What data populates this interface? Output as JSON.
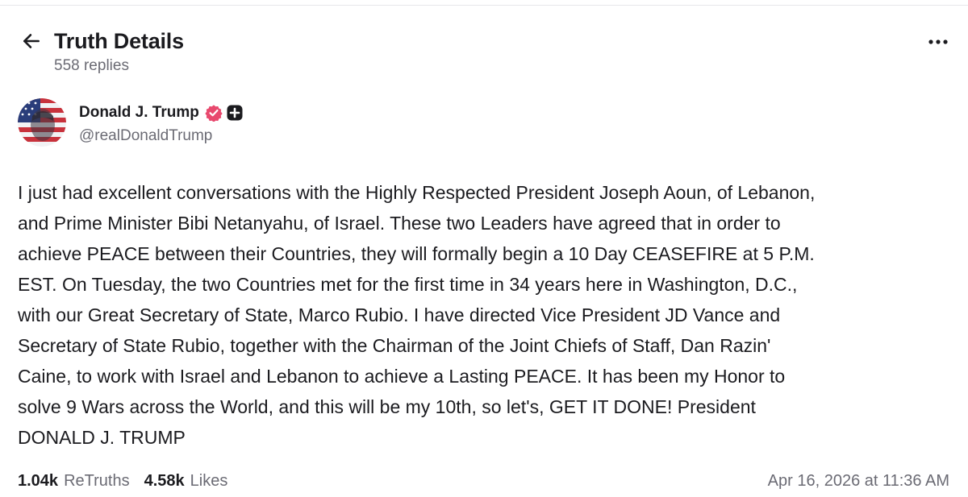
{
  "header": {
    "title": "Truth Details",
    "reply_count": "558 replies",
    "back_icon": "arrow-left-icon",
    "more_icon": "more-horizontal-icon"
  },
  "author": {
    "display_name": "Donald J. Trump",
    "handle": "@realDonaldTrump",
    "verified_color": "#e8496e",
    "badges": [
      "verified-badge-icon",
      "plus-badge-icon"
    ]
  },
  "post": {
    "text": "I just had excellent conversations with the Highly Respected President Joseph Aoun, of Lebanon,\nand Prime Minister Bibi Netanyahu, of Israel. These two Leaders have agreed that in order to\nachieve PEACE between their Countries, they will formally begin a 10 Day CEASEFIRE at 5 P.M.\nEST. On Tuesday, the two Countries met for the first time in 34 years here in Washington, D.C.,\nwith our Great Secretary of State, Marco Rubio. I have directed Vice President JD Vance and\nSecretary of State Rubio, together with the Chairman of the Joint Chiefs of Staff, Dan Razin'\nCaine, to work with Israel and Lebanon to achieve a Lasting PEACE. It has been my Honor to\nsolve 9 Wars across the World, and this will be my 10th, so let's, GET IT DONE! President\nDONALD J. TRUMP"
  },
  "stats": {
    "retruths_count": "1.04k",
    "retruths_label": "ReTruths",
    "likes_count": "4.58k",
    "likes_label": "Likes"
  },
  "timestamp": "Apr 16, 2026 at 11:36 AM"
}
